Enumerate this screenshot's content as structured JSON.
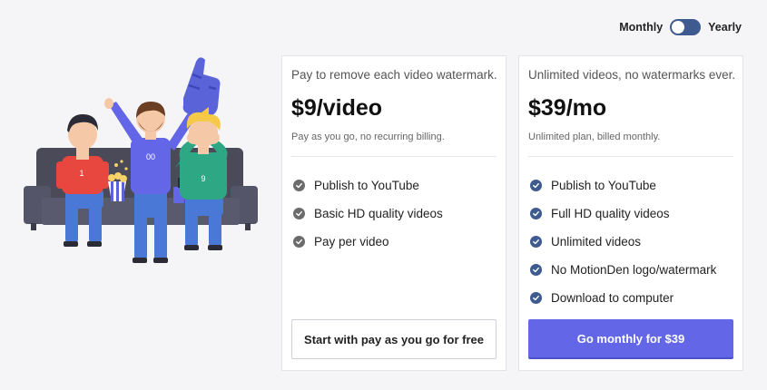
{
  "billing_toggle": {
    "left_label": "Monthly",
    "right_label": "Yearly",
    "selected": "Monthly"
  },
  "illustration": {
    "shirt_numbers": [
      "1",
      "00",
      "9"
    ]
  },
  "plans": [
    {
      "tagline": "Pay to remove each video watermark.",
      "price": "$9/video",
      "subtitle": "Pay as you go, no recurring billing.",
      "features": [
        "Publish to YouTube",
        "Basic HD quality videos",
        "Pay per video"
      ],
      "button_label": "Start with pay as you go for free",
      "check_color": "#6b6b6b"
    },
    {
      "tagline": "Unlimited videos, no watermarks ever.",
      "price": "$39/mo",
      "subtitle": "Unlimited plan, billed monthly.",
      "features": [
        "Publish to YouTube",
        "Full HD quality videos",
        "Unlimited videos",
        "No MotionDen logo/watermark",
        "Download to computer"
      ],
      "button_label": "Go monthly for $39",
      "check_color": "#3e5a8e",
      "button_color": "#6366e6"
    }
  ],
  "colors": {
    "accent": "#6366e6",
    "toggle": "#3e5a8e",
    "background": "#f5f5f8"
  }
}
